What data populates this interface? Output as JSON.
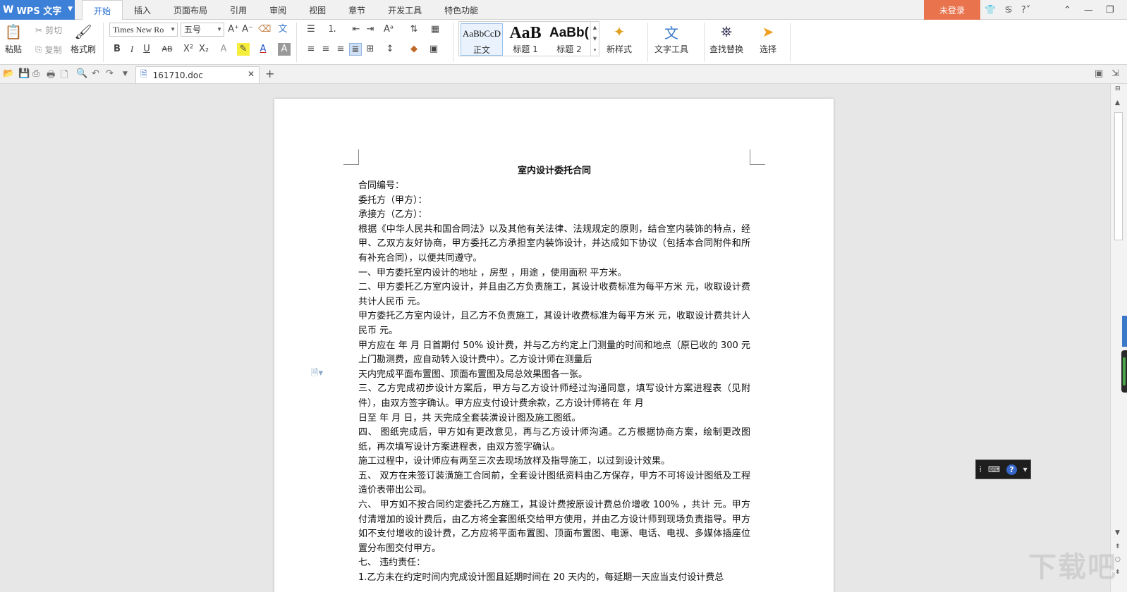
{
  "app": {
    "name": "WPS 文字",
    "logo": "W"
  },
  "tabs": [
    "开始",
    "插入",
    "页面布局",
    "引用",
    "审阅",
    "视图",
    "章节",
    "开发工具",
    "特色功能"
  ],
  "active_tab": "开始",
  "login_label": "未登录",
  "ribbon": {
    "paste": "粘贴",
    "cut": "剪切",
    "copy": "复制",
    "format_painter": "格式刷",
    "font_name": "Times New Ro",
    "font_size": "五号",
    "styles": [
      {
        "sample": "AaBbCcD",
        "name": "正文"
      },
      {
        "sample": "AaB",
        "name": "标题 1"
      },
      {
        "sample": "AaBb(",
        "name": "标题 2"
      }
    ],
    "new_style": "新样式",
    "text_tools": "文字工具",
    "find_replace": "查找替换",
    "select": "选择"
  },
  "document_tab": {
    "filename": "161710.doc"
  },
  "document": {
    "title": "室内设计委托合同",
    "lines": [
      "合同编号：",
      "委托方（甲方）：",
      "承接方（乙方）：",
      "根据《中华人民共和国合同法》以及其他有关法律、法规规定的原则，结合室内装饰的特点，经甲、乙双方友好协商，甲方委托乙方承担室内装饰设计，并达成如下协议（包括本合同附件和所有补充合同），以便共同遵守。",
      "一、甲方委托室内设计的地址 ，房型 ，用途 ，使用面积 平方米。",
      "二、甲方委托乙方室内设计，并且由乙方负责施工，其设计收费标准为每平方米 元，收取设计费共计人民币 元。",
      "甲方委托乙方室内设计，且乙方不负责施工，其设计收费标准为每平方米 元，收取设计费共计人民币 元。",
      "甲方应在 年 月 日首期付 50% 设计费，并与乙方约定上门测量的时间和地点（原已收的 300 元上门勘测费，应自动转入设计费中）。乙方设计师在测量后",
      "天内完成平面布置图、顶面布置图及局总效果图各一张。",
      "三、乙方完成初步设计方案后，甲方与乙方设计师经过沟通同意，填写设计方案进程表（见附件），由双方签字确认。甲方应支付设计费余款，乙方设计师将在 年 月",
      "日至 年 月 日，共 天完成全套装潢设计图及施工图纸。",
      "四、 图纸完成后，甲方如有更改意见，再与乙方设计师沟通。乙方根据协商方案，绘制更改图纸，再次填写设计方案进程表，由双方签字确认。",
      "施工过程中，设计师应有两至三次去现场放样及指导施工，以过到设计效果。",
      "五、 双方在未签订装潢施工合同前，全套设计图纸资料由乙方保存，甲方不可将设计图纸及工程造价表带出公司。",
      "六、 甲方如不按合同约定委托乙方施工，其设计费按原设计费总价增收 100% ，共计 元。甲方付清增加的设计费后，由乙方将全套图纸交给甲方使用，并由乙方设计师到现场负责指导。甲方如不支付增收的设计费，乙方应将平面布置图、顶面布置图、电源、电话、电视、多媒体插座位置分布图交付甲方。",
      "七、 违约责任：",
      "1.乙方未在约定时间内完成设计图且延期时间在 20 天内的，每延期一天应当支付设计费总"
    ]
  },
  "watermark": "下载吧",
  "colors": {
    "app_blue": "#3d80d8",
    "login_orange": "#e8734d",
    "active_tab_text": "#1d6ad0"
  }
}
